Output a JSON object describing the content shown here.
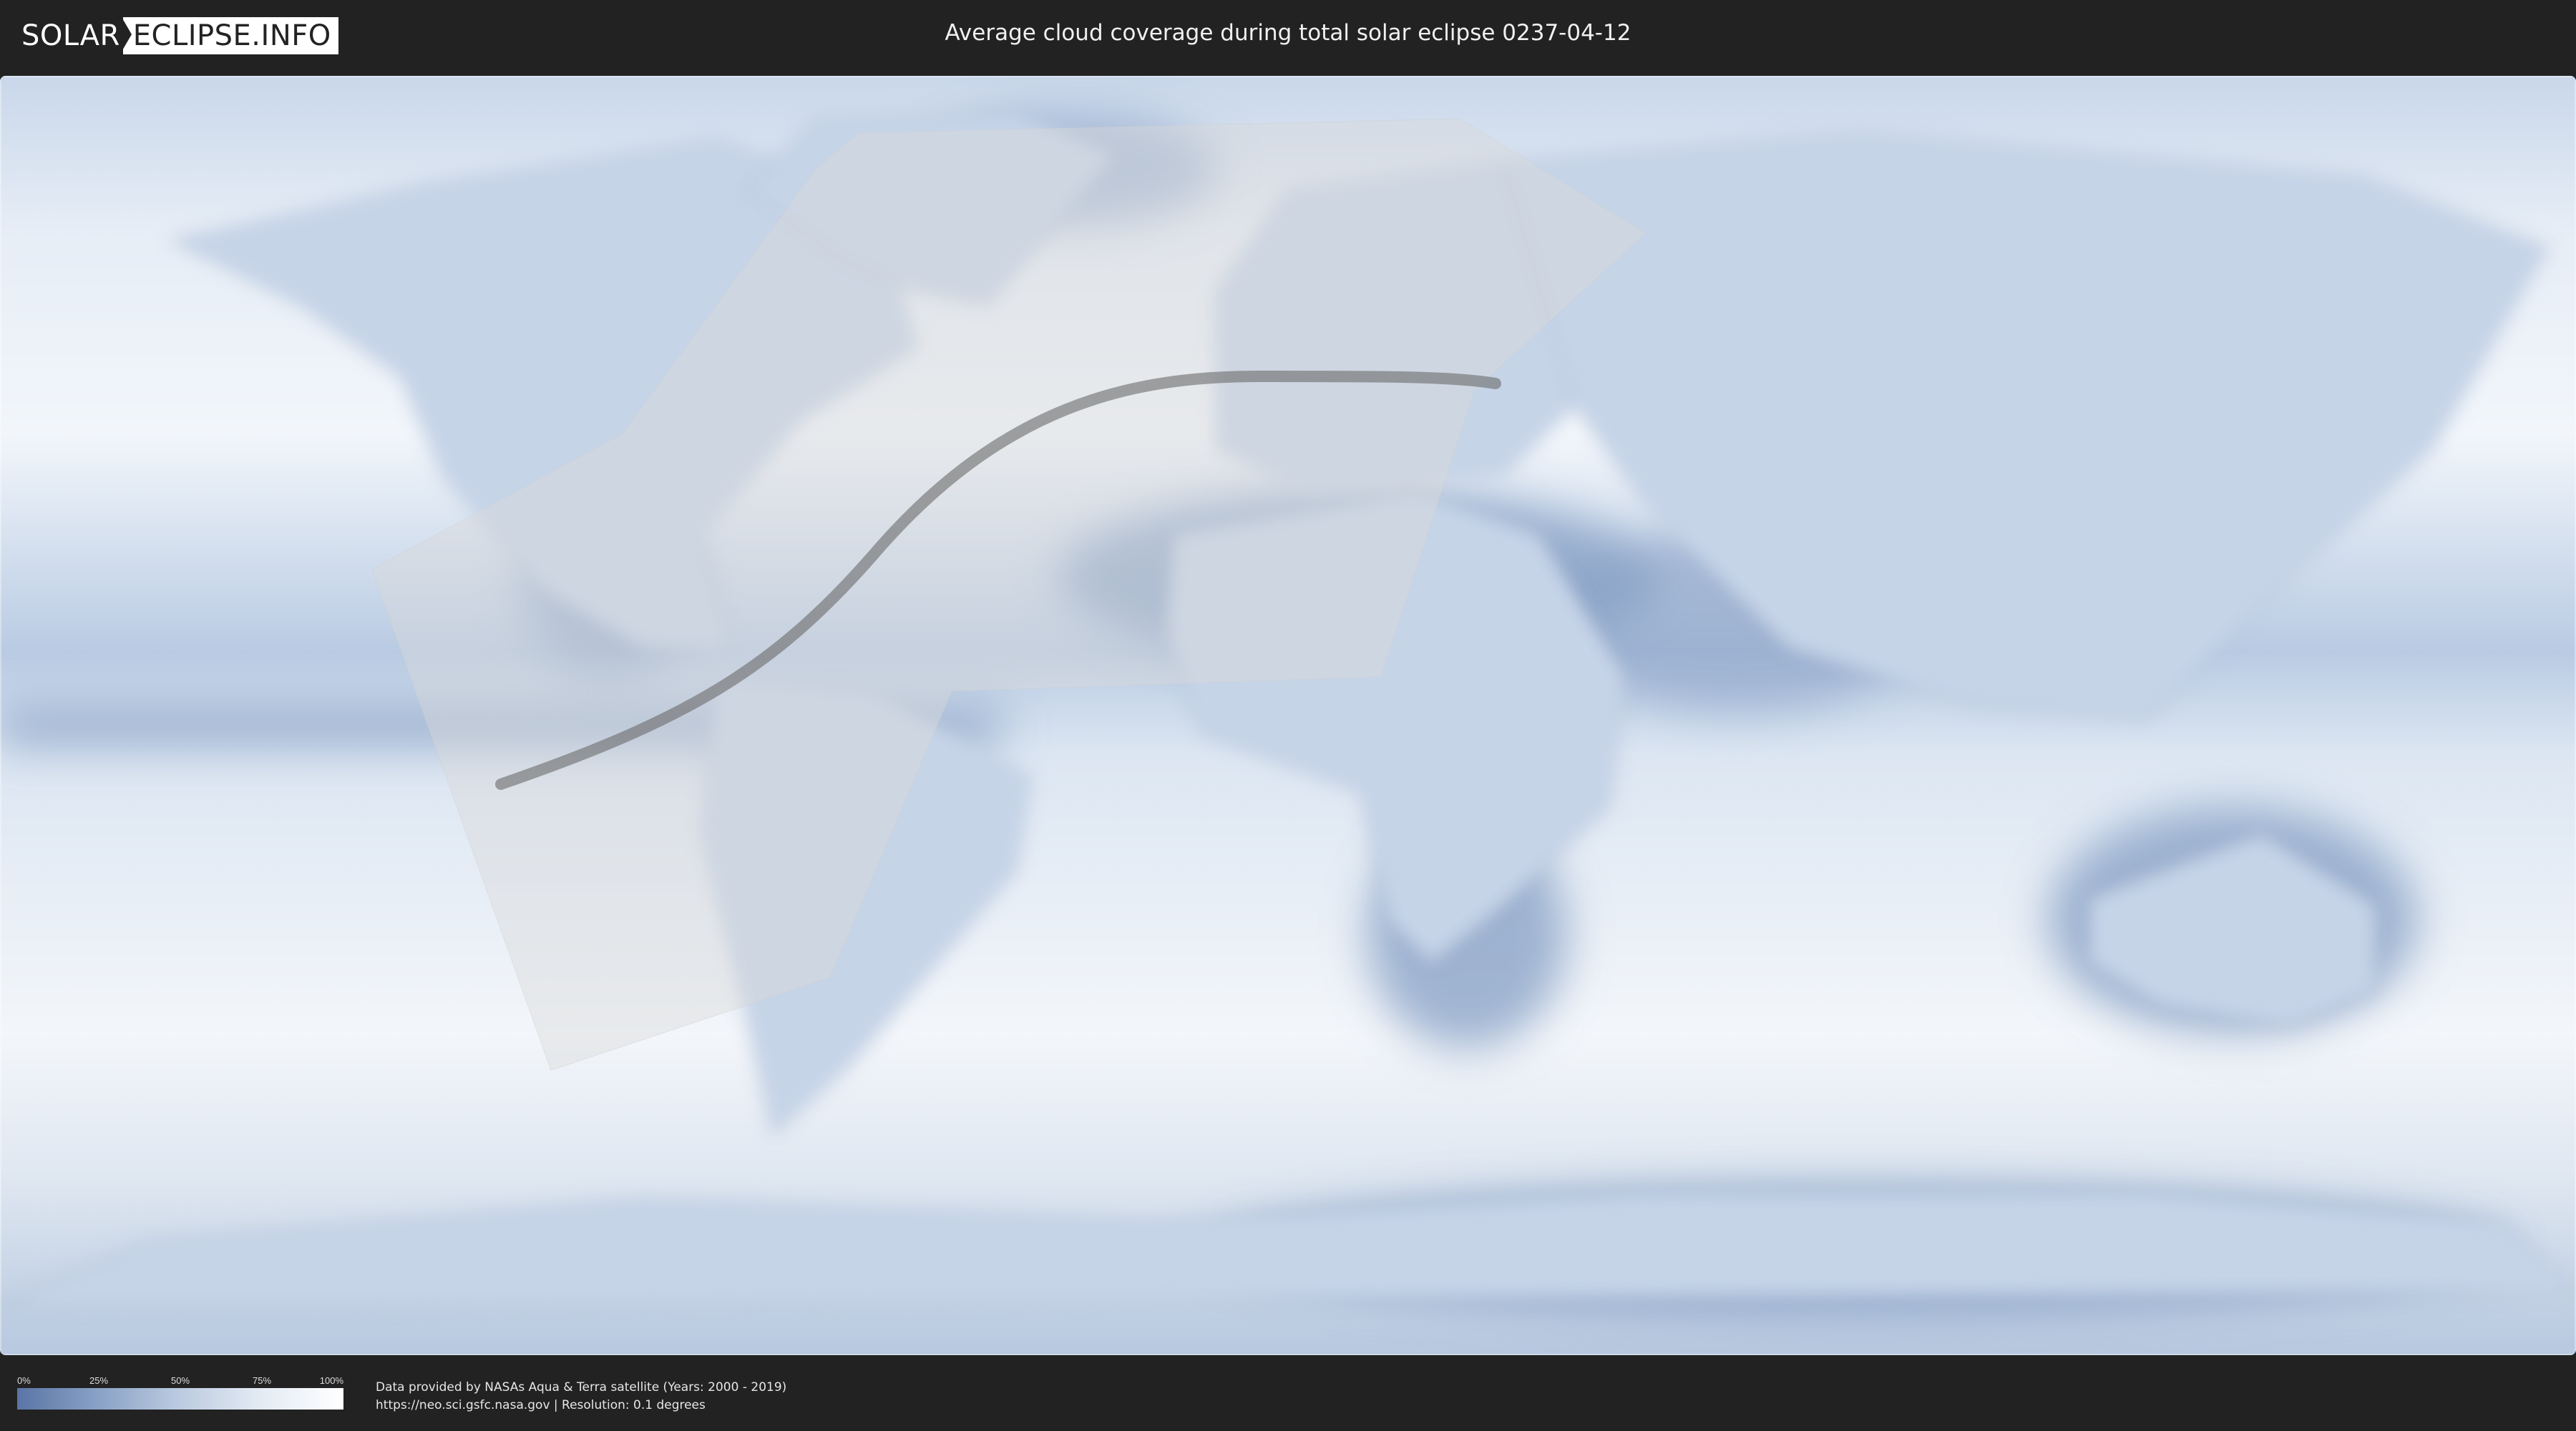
{
  "logo": {
    "part1": "SOLAR",
    "part2": "ECLIPSE.INFO"
  },
  "title": "Average cloud coverage during total solar eclipse 0237-04-12",
  "legend": {
    "ticks": [
      "0%",
      "25%",
      "50%",
      "75%",
      "100%"
    ],
    "colors": {
      "low": "#5a75a6",
      "high": "#ffffff"
    }
  },
  "credits": {
    "line1": "Data provided by NASAs Aqua & Terra satellite (Years: 2000 - 2019)",
    "line2": "https://neo.sci.gsfc.nasa.gov | Resolution: 0.1 degrees"
  },
  "map": {
    "projection": "equirectangular",
    "layers": [
      "cloud-coverage",
      "country-borders",
      "eclipse-visibility-zone",
      "eclipse-central-path"
    ],
    "colors": {
      "ocean_cloud": "#dfe8f3",
      "clear_sky": "#7e98c0",
      "eclipse_zone": "#d9d9d9",
      "central_path": "#6b6b6b"
    }
  }
}
